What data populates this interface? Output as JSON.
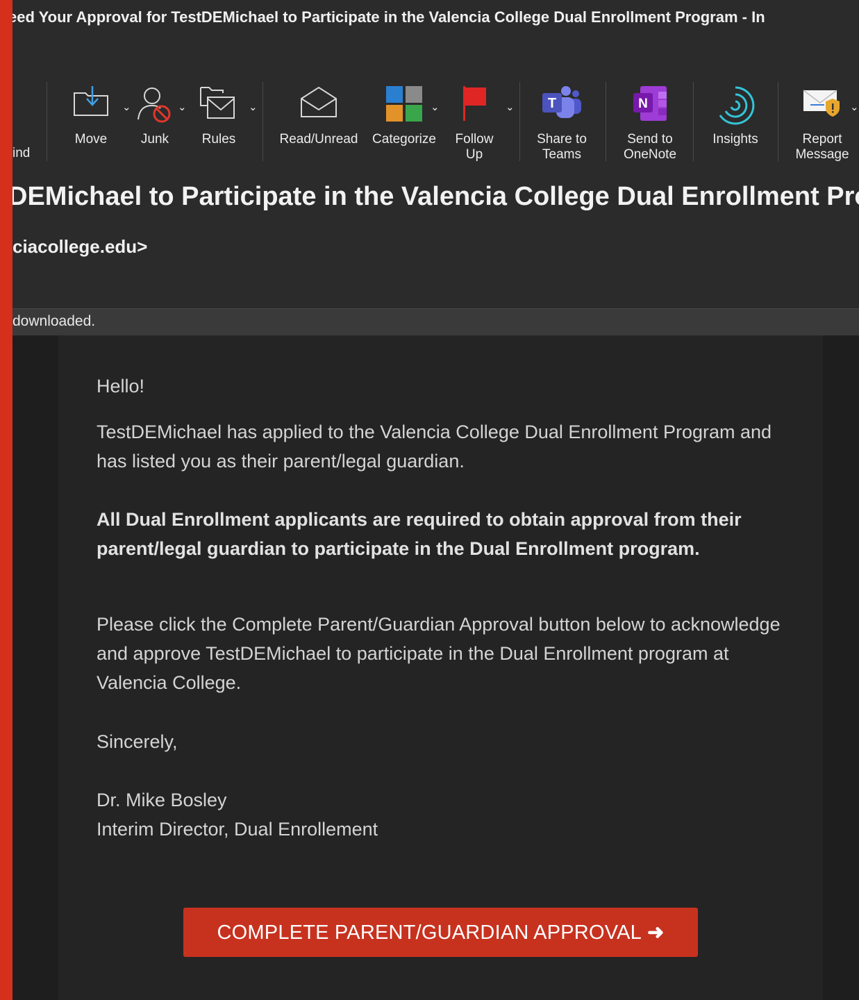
{
  "window": {
    "title": "eed Your Approval for TestDEMichael to Participate in the Valencia College Dual Enrollment Program - In"
  },
  "ribbon": {
    "partial_label": "ind",
    "buttons": [
      {
        "name": "move",
        "label": "Move",
        "icon": "move-folder-icon"
      },
      {
        "name": "junk",
        "label": "Junk",
        "icon": "junk-person-icon"
      },
      {
        "name": "rules",
        "label": "Rules",
        "icon": "rules-mail-icon"
      },
      {
        "name": "read-unread",
        "label": "Read/Unread",
        "icon": "open-envelope-icon"
      },
      {
        "name": "categorize",
        "label": "Categorize",
        "icon": "category-grid-icon"
      },
      {
        "name": "follow-up",
        "label": "Follow\nUp",
        "icon": "flag-icon"
      },
      {
        "name": "share-to-teams",
        "label": "Share to\nTeams",
        "icon": "teams-icon"
      },
      {
        "name": "send-to-onenote",
        "label": "Send to\nOneNote",
        "icon": "onenote-icon"
      },
      {
        "name": "insights",
        "label": "Insights",
        "icon": "insights-icon"
      },
      {
        "name": "report-message",
        "label": "Report\nMessage",
        "icon": "report-envelope-icon"
      }
    ]
  },
  "message": {
    "subject": "DEMichael to Participate in the Valencia College Dual Enrollment Pro",
    "sender": "ciacollege.edu>",
    "infobar": "downloaded.",
    "greeting": "Hello!",
    "para1": "TestDEMichael has applied to the Valencia College Dual Enrollment Program and has listed you as their parent/legal guardian.",
    "para2": "All Dual Enrollment applicants are required to obtain approval from their parent/legal guardian to participate in the Dual Enrollment program.",
    "para3": "Please click the Complete Parent/Guardian Approval button below to acknowledge and approve TestDEMichael to participate in the Dual Enrollment program at Valencia College.",
    "closing": "Sincerely,",
    "signer_name": "Dr. Mike Bosley",
    "signer_title": "Interim Director, Dual Enrollement",
    "cta_label": "COMPLETE PARENT/GUARDIAN APPROVAL",
    "cta_arrow": "➜"
  },
  "colors": {
    "accent_red": "#c7321f",
    "strip_red": "#d4301c",
    "toolbar_bg": "#2b2b2b",
    "body_bg": "#242424"
  }
}
